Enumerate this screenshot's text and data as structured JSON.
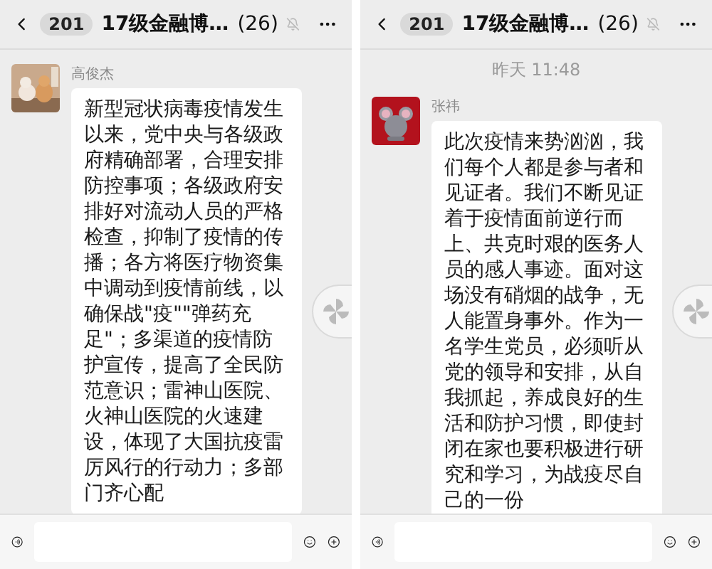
{
  "panels": [
    {
      "header": {
        "unread": "201",
        "title": "17级金融博…",
        "count": "(26)",
        "muted": true
      },
      "messages": [
        {
          "kind": "cut"
        },
        {
          "kind": "text",
          "sender": "高俊杰",
          "text": "新型冠状病毒疫情发生以来，党中央与各级政府精确部署，合理安排防控事项；各级政府安排好对流动人员的严格检查，抑制了疫情的传播；各方将医疗物资集中调动到疫情前线，以确保战\"疫\"\"弹药充足\"；多渠道的疫情防护宣传，提高了全民防范意识；雷神山医院、火神山医院的火速建设，体现了大国抗疫雷厉风行的行动力；多部门齐心配"
        }
      ]
    },
    {
      "header": {
        "unread": "201",
        "title": "17级金融博…",
        "count": "(26)",
        "muted": true
      },
      "messages": [
        {
          "kind": "time",
          "text": "昨天 11:48"
        },
        {
          "kind": "text",
          "sender": "张祎",
          "avatar": {
            "kind": "icon"
          },
          "text": "此次疫情来势汹汹，我们每个人都是参与者和见证者。我们不断见证着于疫情面前逆行而上、共克时艰的医务人员的感人事迹。面对这场没有硝烟的战争，无人能置身事外。作为一名学生党员，必须听从党的领导和安排，从自我抓起，养成良好的生活和防护习惯，即使封闭在家也要积极进行研究和学习，为战疫尽自己的一份"
        }
      ]
    }
  ]
}
